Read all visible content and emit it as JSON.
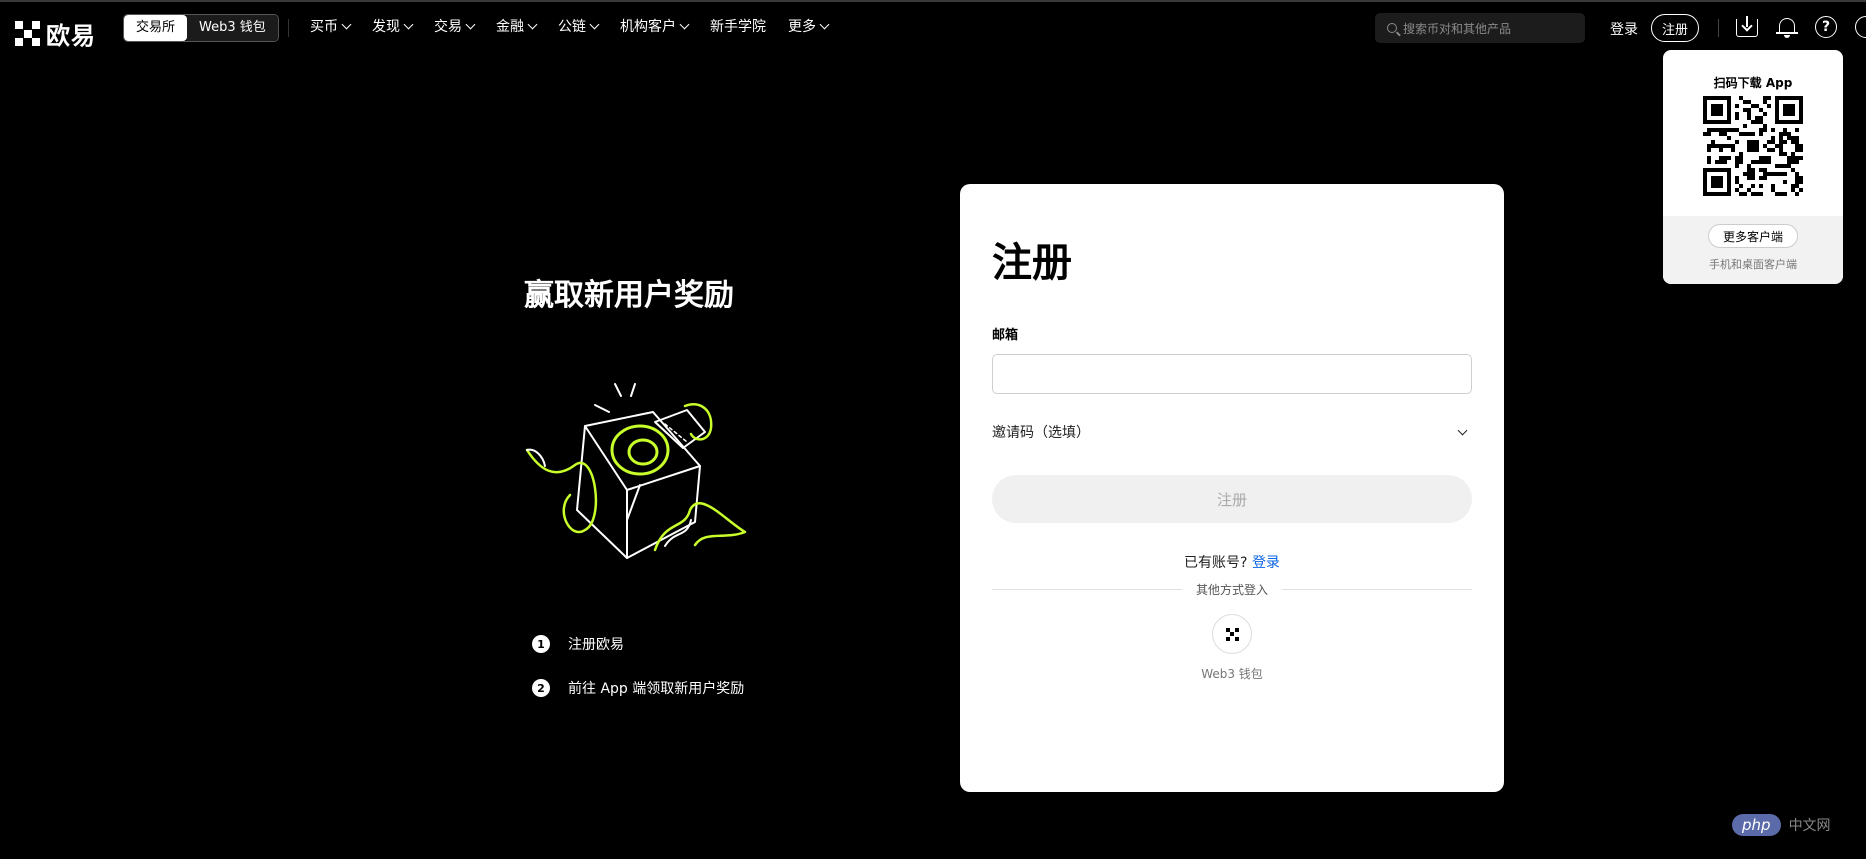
{
  "brand": {
    "name": "欧易",
    "accent": "#c8ff2a"
  },
  "header": {
    "modes": [
      {
        "label": "交易所",
        "active": true
      },
      {
        "label": "Web3 钱包",
        "active": false
      }
    ],
    "nav": [
      "买币",
      "发现",
      "交易",
      "金融",
      "公链",
      "机构客户",
      "新手学院",
      "更多"
    ],
    "search_placeholder": "搜索币对和其他产品",
    "login_label": "登录",
    "register_label": "注册",
    "help_glyph": "?"
  },
  "promo": {
    "title": "赢取新用户奖励",
    "steps": [
      {
        "num": "1",
        "text": "注册欧易"
      },
      {
        "num": "2",
        "text": "前往 App 端领取新用户奖励"
      }
    ]
  },
  "form": {
    "title": "注册",
    "email_label": "邮箱",
    "email_value": "",
    "invite_label": "邀请码（选填）",
    "submit_label": "注册",
    "have_account_text": "已有账号?",
    "login_link": "登录",
    "other_methods": "其他方式登入",
    "web3_label": "Web3 钱包"
  },
  "qr_popup": {
    "title": "扫码下载 App",
    "more_button": "更多客户端",
    "subtitle": "手机和桌面客户端"
  },
  "watermark": {
    "badge": "php",
    "text": "中文网"
  }
}
